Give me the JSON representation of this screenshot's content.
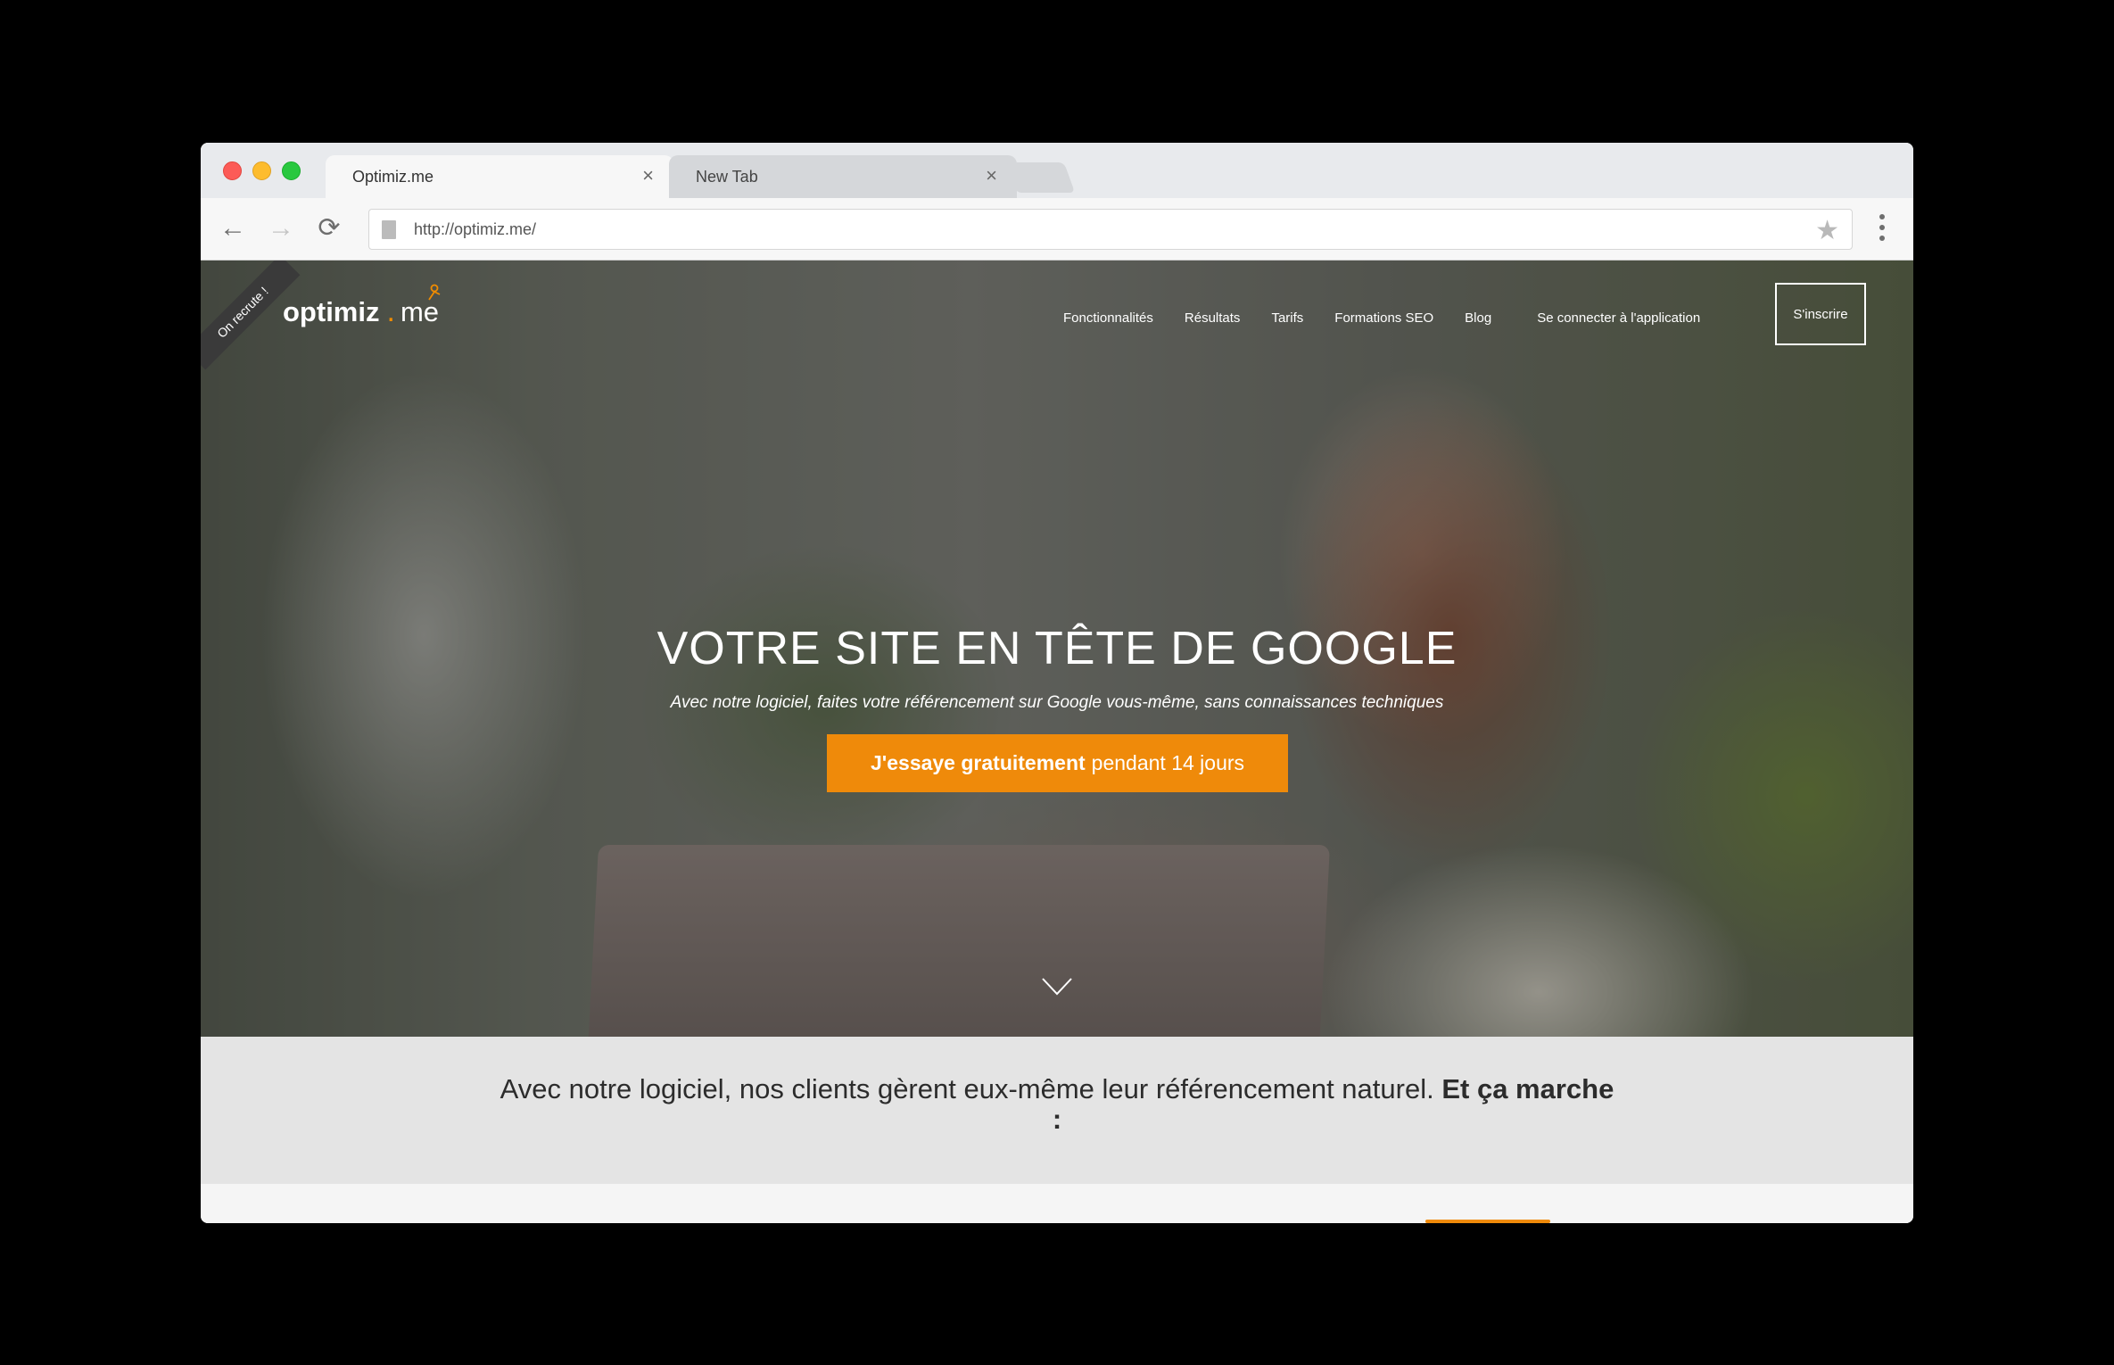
{
  "browser": {
    "tabs": [
      {
        "title": "Optimiz.me",
        "close_icon": "×"
      },
      {
        "title": "New Tab",
        "close_icon": "×"
      }
    ],
    "url": "http://optimiz.me/",
    "icons": {
      "back": "←",
      "forward": "→",
      "reload": "⟳",
      "bookmark": "★"
    }
  },
  "site": {
    "ribbon": "On recrute !",
    "logo": {
      "main": "optimiz",
      "dot": ".",
      "sub": "me"
    },
    "nav": {
      "items": [
        "Fonctionnalités",
        "Résultats",
        "Tarifs",
        "Formations SEO",
        "Blog"
      ],
      "connect": "Se connecter à l'application",
      "signup": "S'inscrire"
    },
    "hero": {
      "title": "VOTRE SITE EN TÊTE DE GOOGLE",
      "subtitle": "Avec notre logiciel, faites votre référencement sur Google vous-même, sans connaissances techniques",
      "cta_strong": "J'essaye gratuitement",
      "cta_rest": "pendant 14 jours"
    },
    "band": {
      "text": "Avec notre logiciel, nos clients gèrent eux-même leur référencement naturel.",
      "strong": "Et ça marche",
      "colon": ":"
    },
    "colors": {
      "accent": "#ef8a0a"
    }
  }
}
